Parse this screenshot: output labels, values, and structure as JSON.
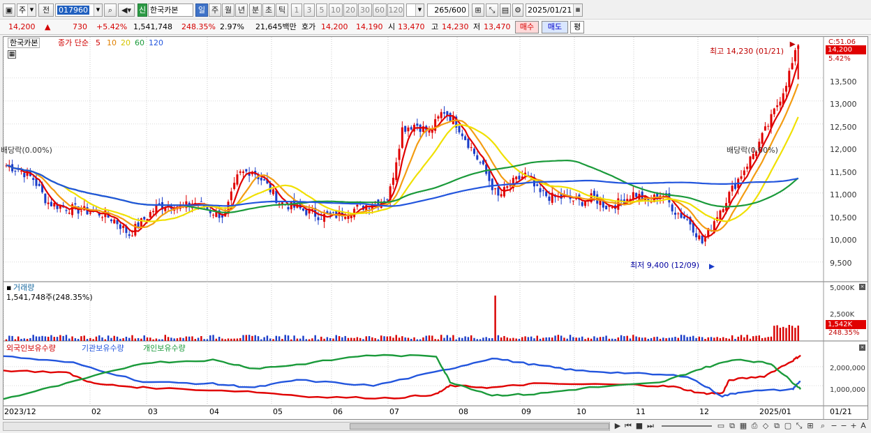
{
  "toolbar": {
    "period_labels": [
      "주",
      "전"
    ],
    "stock_code": "017960",
    "stock_name": "한국카본",
    "credit_badge": "신",
    "timeframes": [
      "일",
      "주",
      "월",
      "년",
      "분",
      "초",
      "틱"
    ],
    "active_timeframe": "일",
    "minute_steps": [
      "1",
      "3",
      "5",
      "10",
      "20",
      "30",
      "60",
      "120"
    ],
    "count_value": "265",
    "count_max": "/600",
    "date_value": "2025/01/21"
  },
  "quote": {
    "price": "14,200",
    "change_arrow": "▲",
    "change": "730",
    "change_rate": "+5.42%",
    "volume": "1,541,748",
    "volume_ratio": "248.35%",
    "turnover_rate": "2.97%",
    "amount": "21,645백만",
    "bid_label": "호가",
    "ask": "14,200",
    "bid": "14,190",
    "open_label": "시",
    "open": "13,470",
    "high_label": "고",
    "high": "14,230",
    "low_label": "저",
    "low": "13,470",
    "buy_button": "매수",
    "sell_button": "매도",
    "eval_button": "평"
  },
  "price_panel": {
    "stock_label": "한국카본",
    "legend_prefix": "종가 단순",
    "ma_periods": [
      "5",
      "10",
      "20",
      "60",
      "120"
    ],
    "ma_colors": [
      "#e00000",
      "#f39c12",
      "#f0e000",
      "#1a9a3a",
      "#2255dd"
    ],
    "high_annotation": "최고 14,230 (01/21)",
    "low_annotation": "최저 9,400 (12/09)",
    "dividend_left": "배당락(0.00%)",
    "dividend_right": "배당락(0.00%)",
    "right_top_label": "C:51.06",
    "current_price_tag": "14,200",
    "current_rate_tag": "5.42%",
    "y_ticks": [
      "13,500",
      "13,000",
      "12,500",
      "12,000",
      "11,500",
      "11,000",
      "10,500",
      "10,000",
      "9,500"
    ]
  },
  "volume_panel": {
    "title": "거래량",
    "value_label": "1,541,748주(248.35%)",
    "y_ticks": [
      "5,000K",
      "2,500K"
    ],
    "current_tag": "1,542K",
    "current_rate": "248.35%"
  },
  "holdings_panel": {
    "legend": [
      "외국인보유수량",
      "기관보유수량",
      "개인보유수량"
    ],
    "colors": [
      "#e00000",
      "#2255dd",
      "#1a9a3a"
    ],
    "y_ticks": [
      "2,000,000",
      "1,000,000"
    ]
  },
  "x_axis": {
    "labels": [
      "2023/12",
      "02",
      "03",
      "04",
      "05",
      "06",
      "07",
      "08",
      "09",
      "10",
      "11",
      "12",
      "2025/01"
    ],
    "right_label": "01/21"
  },
  "chart_data": {
    "type": "line",
    "price": {
      "close_approx": [
        11600,
        11500,
        11300,
        10800,
        10700,
        10650,
        10600,
        10550,
        10400,
        10100,
        10400,
        10700,
        10750,
        10700,
        10800,
        10600,
        10500,
        11400,
        11500,
        11200,
        10800,
        10700,
        10600,
        10500,
        10500,
        10600,
        10700,
        10800,
        10900,
        12400,
        12500,
        12300,
        12800,
        12500,
        12000,
        11500,
        10900,
        11200,
        11400,
        11000,
        10900,
        10900,
        10800,
        10900,
        10700,
        10800,
        11000,
        10800,
        11000,
        10600,
        10400,
        9900,
        10500,
        11000,
        11500,
        12000,
        12600,
        13300,
        14200
      ],
      "high": 14230,
      "low": 9400,
      "ylim": [
        9300,
        14300
      ]
    },
    "volume": {
      "last": "1,542K",
      "ylim_max_k": 5000
    },
    "holdings_series": [
      "외국인보유수량",
      "기관보유수량",
      "개인보유수량"
    ]
  }
}
